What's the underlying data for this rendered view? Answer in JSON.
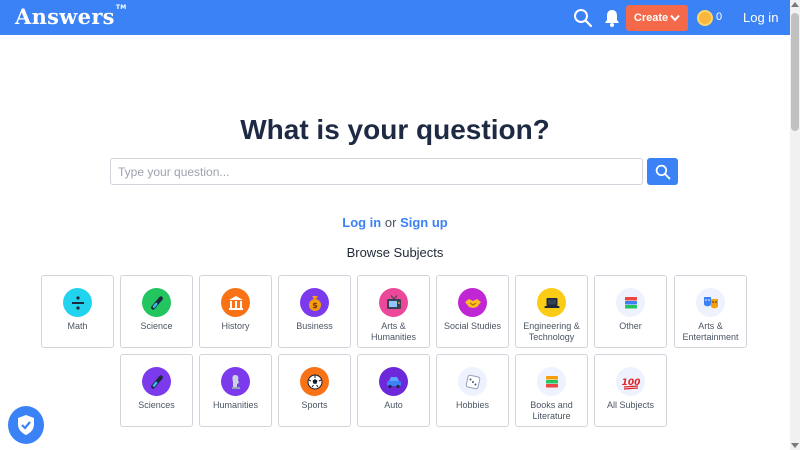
{
  "header": {
    "logo": "Answers",
    "logo_tm": "TM",
    "create_label": "Create",
    "coin_count": "0",
    "login_label": "Log in"
  },
  "main": {
    "title": "What is your question?",
    "search_placeholder": "Type your question...",
    "login_text": "Log in",
    "or_text": "or",
    "signup_text": "Sign up",
    "browse_title": "Browse Subjects"
  },
  "subjects": [
    {
      "label": "Math",
      "icon": "divide-icon",
      "color": "#22d3ee"
    },
    {
      "label": "Science",
      "icon": "test-tube-icon",
      "color": "#22c55e"
    },
    {
      "label": "History",
      "icon": "museum-icon",
      "color": "#f97316"
    },
    {
      "label": "Business",
      "icon": "money-bag-icon",
      "color": "#7c3aed"
    },
    {
      "label": "Arts & Humanities",
      "icon": "tv-icon",
      "color": "#ec4899"
    },
    {
      "label": "Social Studies",
      "icon": "handshake-icon",
      "color": "#c026d3"
    },
    {
      "label": "Engineering & Technology",
      "icon": "laptop-icon",
      "color": "#facc15"
    },
    {
      "label": "Other",
      "icon": "books-icon",
      "color": "#eef2ff"
    },
    {
      "label": "Arts & Entertainment",
      "icon": "theater-masks-icon",
      "color": "#eef2ff"
    },
    {
      "label": "Sciences",
      "icon": "test-tube-icon",
      "color": "#7c3aed"
    },
    {
      "label": "Humanities",
      "icon": "statue-icon",
      "color": "#7c3aed"
    },
    {
      "label": "Sports",
      "icon": "soccer-ball-icon",
      "color": "#f97316"
    },
    {
      "label": "Auto",
      "icon": "car-icon",
      "color": "#6d28d9"
    },
    {
      "label": "Hobbies",
      "icon": "dice-icon",
      "color": "#eef2ff"
    },
    {
      "label": "Books and Literature",
      "icon": "books-icon",
      "color": "#eef2ff"
    },
    {
      "label": "All Subjects",
      "icon": "hundred-points-icon",
      "color": "#eef2ff"
    }
  ],
  "colors": {
    "brand_blue": "#3b82f6",
    "create_orange": "#f4694a",
    "title_navy": "#1e2a44"
  }
}
